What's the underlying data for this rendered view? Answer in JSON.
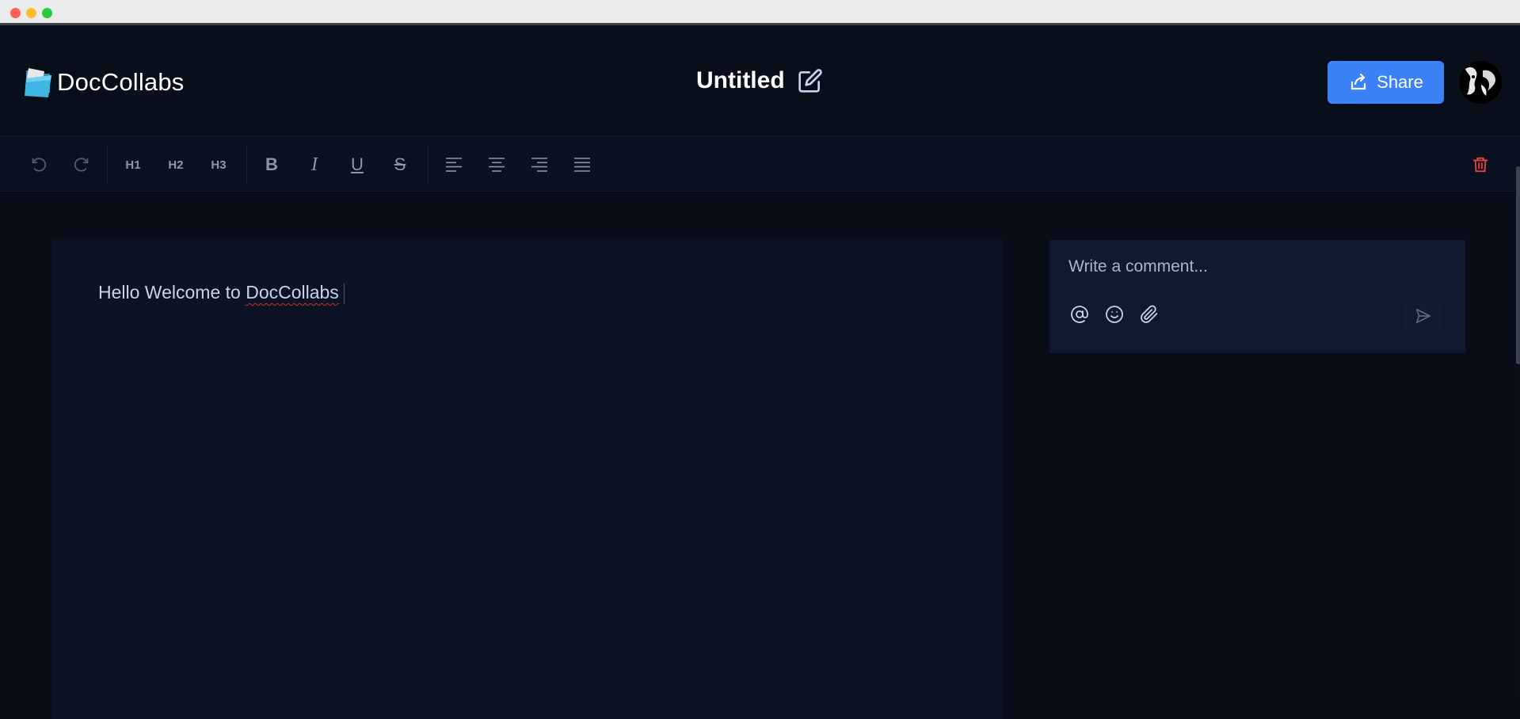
{
  "app": {
    "brand_name": "DocCollabs",
    "doc_title": "Untitled",
    "accent_color": "#3b82f6"
  },
  "header": {
    "share_label": "Share"
  },
  "toolbar": {
    "undo_icon": "undo-icon",
    "redo_icon": "redo-icon",
    "headings": [
      "H1",
      "H2",
      "H3"
    ],
    "format": {
      "bold": "B",
      "italic": "I",
      "underline": "U",
      "strike": "S"
    },
    "align_icons": [
      "align-left-icon",
      "align-center-icon",
      "align-right-icon",
      "align-justify-icon"
    ],
    "delete_icon": "trash-icon",
    "delete_color": "#ef4444"
  },
  "editor": {
    "text_before": "Hello Welcome to ",
    "text_misspelled": "DocCollabs"
  },
  "comment": {
    "placeholder": "Write a comment...",
    "icons": [
      "at-icon",
      "emoji-icon",
      "paperclip-icon",
      "send-icon"
    ]
  }
}
